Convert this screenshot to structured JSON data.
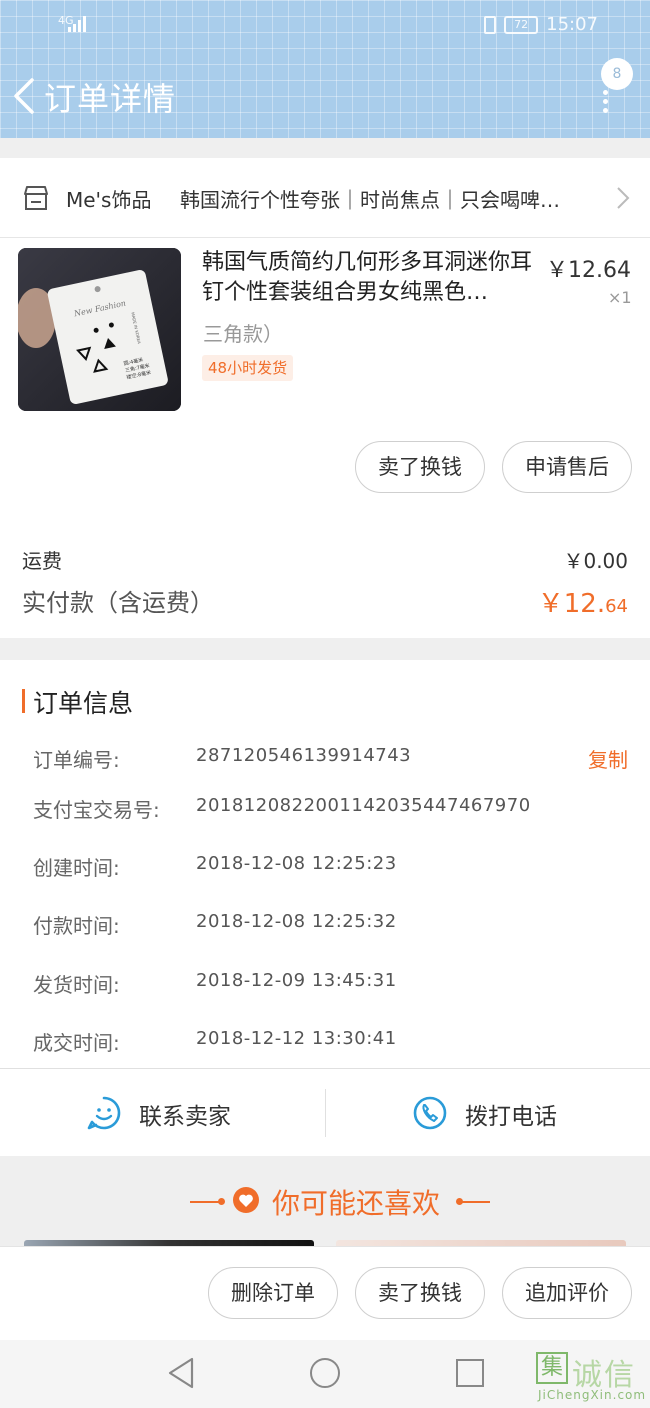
{
  "status_bar": {
    "network": "4G",
    "battery": "72",
    "time": "15:07"
  },
  "header": {
    "title": "订单详情",
    "badge_count": "8"
  },
  "store": {
    "name": "Me's饰品",
    "tagline": "韩国流行个性夸张｜时尚焦点｜只会喝啤…"
  },
  "product": {
    "title": "韩国气质简约几何形多耳洞迷你耳钉个性套装组合男女纯黑色…",
    "price": "￥12.64",
    "quantity": "×1",
    "variant": "三角款）",
    "shipping_tag": "48小时发货",
    "card_text_1": "New Fashion",
    "card_text_2": "圆:4毫米",
    "card_text_3": "三角:7毫米",
    "card_text_4": "镂空:8毫米",
    "card_text_5": "MADE IN KOREA"
  },
  "item_actions": {
    "sell_label": "卖了换钱",
    "after_sale_label": "申请售后"
  },
  "fees": {
    "shipping_label": "运费",
    "shipping_value": "￥0.00",
    "total_label": "实付款（含运费）",
    "total_main": "￥12.",
    "total_cents": "64"
  },
  "order_info": {
    "title": "订单信息",
    "copy_label": "复制",
    "rows": [
      {
        "key": "订单编号:",
        "value": "287120546139914743"
      },
      {
        "key": "支付宝交易号:",
        "value": "2018120822001142035447467970"
      },
      {
        "key": "创建时间:",
        "value": "2018-12-08  12:25:23"
      },
      {
        "key": "付款时间:",
        "value": "2018-12-08  12:25:32"
      },
      {
        "key": "发货时间:",
        "value": "2018-12-09  13:45:31"
      },
      {
        "key": "成交时间:",
        "value": "2018-12-12  13:30:41"
      }
    ]
  },
  "contact": {
    "seller_label": "联系卖家",
    "phone_label": "拨打电话"
  },
  "recommend": {
    "title": "你可能还喜欢"
  },
  "bottom_actions": {
    "delete_label": "删除订单",
    "sell_label": "卖了换钱",
    "review_label": "追加评价"
  },
  "watermark": {
    "text": "诚信",
    "logo": "集",
    "sub": "JiChengXin.com"
  },
  "colors": {
    "accent": "#f06d2a",
    "header_bg": "#a9cdeb",
    "contact_icon": "#2a9bd8"
  }
}
